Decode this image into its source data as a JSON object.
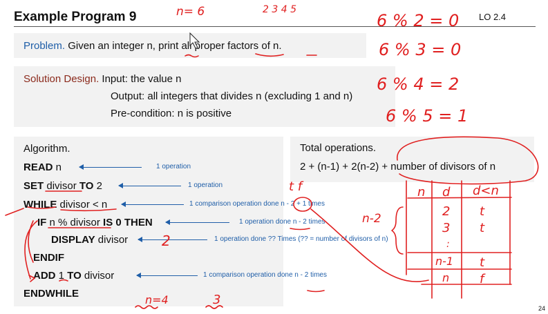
{
  "header": {
    "title": "Example Program 9",
    "lo": "LO 2.4"
  },
  "problem": {
    "label": "Problem.",
    "text": "Given an integer n, print all proper factors of n."
  },
  "solution": {
    "label": "Solution Design.",
    "input": "Input: the value n",
    "output": "Output: all integers that divides n (excluding 1 and n)",
    "precondition": "Pre-condition: n is positive"
  },
  "algorithm": {
    "heading": "Algorithm.",
    "lines": [
      {
        "kw1": "READ",
        "rest": " n"
      },
      {
        "kw1": "SET",
        "mid": " divisor ",
        "kw2": "TO",
        "rest": " 2"
      },
      {
        "kw1": "WHILE",
        "mid": " divisor < n"
      },
      {
        "kw1": "IF",
        "mid": " n % divisor ",
        "kw2": "IS 0 THEN"
      },
      {
        "kw1": "DISPLAY",
        "mid": " divisor"
      },
      {
        "kw1": "ENDIF"
      },
      {
        "kw1": "ADD",
        "mid": " 1 ",
        "kw2": "TO",
        "rest": " divisor"
      },
      {
        "kw1": "ENDWHILE"
      }
    ]
  },
  "notes": [
    "1 operation",
    "1 operation",
    "1 comparison operation done n - 2 + 1 times",
    "1 operation done n - 2 times",
    "1 operation done ?? Times  (?? = number of divisors of n)",
    "1 comparison operation done n - 2 times"
  ],
  "total": {
    "heading": "Total operations.",
    "formula": "2 + (n-1) + 2(n-2) + number of divisors of n"
  },
  "page_number": "24",
  "annotations": {
    "n_eq": "n= 6",
    "digits": "2 3 4 5",
    "m1": "6 % 2 = 0",
    "m2": "6 % 3 = 0",
    "m3": "6 % 4 = 2",
    "m4": "6 % 5 = 1",
    "tf": "t   f",
    "nm2": "n-2",
    "two": "2",
    "n4": "n=4",
    "three": "3",
    "table_headers": [
      "n",
      "d",
      "d<n"
    ],
    "table_rows": [
      [
        "",
        "2",
        "t"
      ],
      [
        "",
        "3",
        "t"
      ],
      [
        "",
        ":",
        ""
      ],
      [
        "n-1",
        "",
        "t"
      ],
      [
        "n",
        "",
        "f"
      ]
    ]
  },
  "ink_color": "#e02020"
}
